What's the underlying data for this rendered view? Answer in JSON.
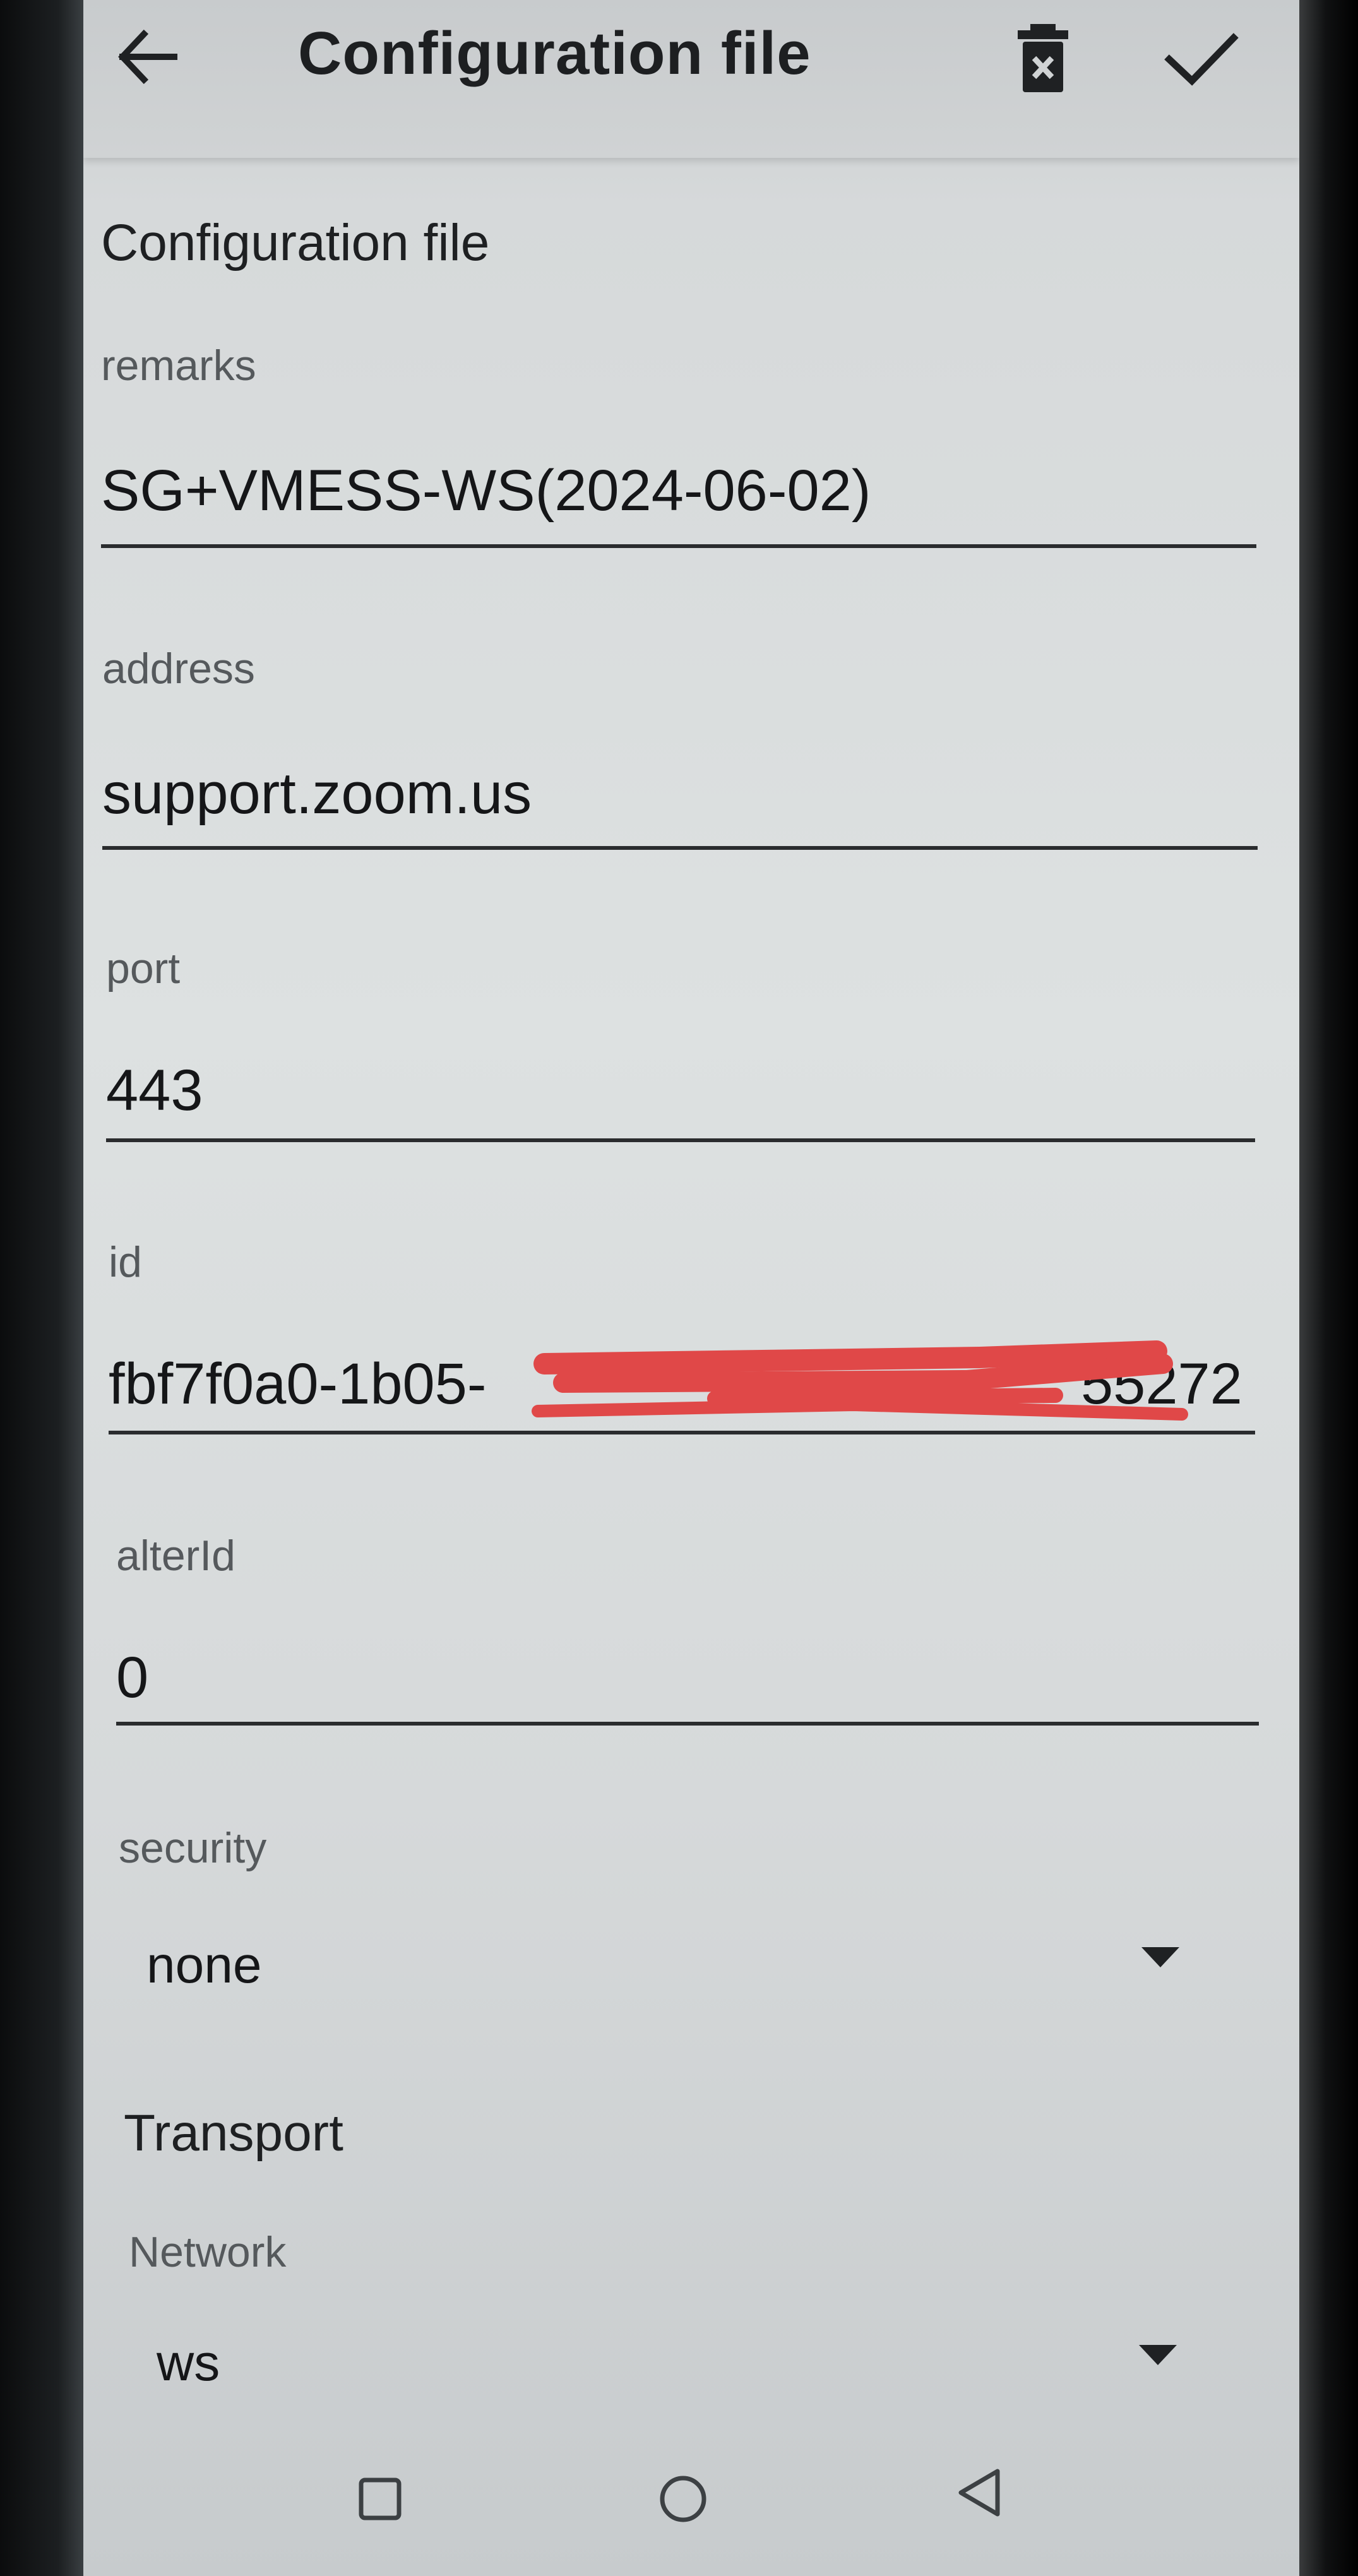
{
  "toolbar": {
    "title": "Configuration file",
    "back_icon": "arrow-left-icon",
    "delete_icon": "delete-icon",
    "save_icon": "check-icon"
  },
  "section_config": {
    "title": "Configuration file"
  },
  "fields": {
    "remarks": {
      "label": "remarks",
      "value": "SG+VMESS-WS(2024-06-02)"
    },
    "address": {
      "label": "address",
      "value": "support.zoom.us"
    },
    "port": {
      "label": "port",
      "value": "443"
    },
    "id": {
      "label": "id",
      "value": "fbf7f0a0-1b05-",
      "value_suffix": "55272"
    },
    "alterId": {
      "label": "alterId",
      "value": "0"
    },
    "security": {
      "label": "security",
      "value": "none"
    }
  },
  "section_transport": {
    "title": "Transport"
  },
  "transport": {
    "network": {
      "label": "Network",
      "value": "ws"
    }
  },
  "colors": {
    "redaction": "#e04848",
    "text_primary": "#151618",
    "text_secondary": "#55595c"
  },
  "navbar": {
    "icons": [
      "square-recents-icon",
      "circle-home-icon",
      "triangle-back-icon"
    ]
  }
}
